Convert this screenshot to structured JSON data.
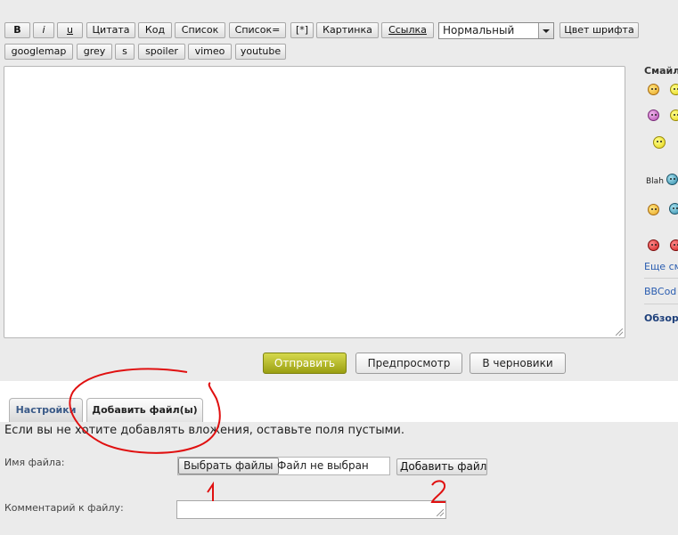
{
  "toolbar": {
    "row1": [
      "B",
      "i",
      "u",
      "Цитата",
      "Код",
      "Список",
      "Список=",
      "[*]",
      "Картинка",
      "Ссылка"
    ],
    "font_size_select": "Нормальный",
    "font_color_button": "Цвет шрифта",
    "row2": [
      "googlemap",
      "grey",
      "s",
      "spoiler",
      "vimeo",
      "youtube"
    ]
  },
  "sidebar": {
    "title": "Смайл",
    "more_smilies": "Еще см",
    "bbcode": "BBCod",
    "browse": "Обзор",
    "blah_text": "Blah"
  },
  "actions": {
    "submit": "Отправить",
    "preview": "Предпросмотр",
    "drafts": "В черновики"
  },
  "tabs": [
    "Настройки",
    "Добавить файл(ы)"
  ],
  "attachments": {
    "hint": "Если вы не хотите добавлять вложения, оставьте поля пустыми.",
    "file_name_label": "Имя файла:",
    "choose_files": "Выбрать файлы",
    "no_file": "Файл не выбран",
    "add_file": "Добавить файл",
    "comment_label": "Комментарий к файлу:",
    "comment_value": ""
  },
  "annotations": {
    "number_1": "1",
    "number_2": "2"
  },
  "colors": {
    "submit_button": "#b7bb2a",
    "annotation_red": "#e01010",
    "link_blue": "#2a5db0"
  }
}
